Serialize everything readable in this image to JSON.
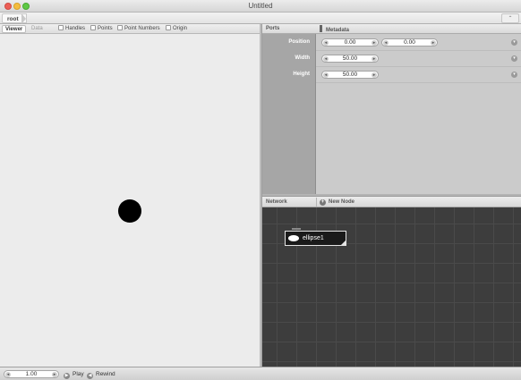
{
  "window": {
    "title": "Untitled"
  },
  "breadcrumb": {
    "root": "root"
  },
  "viewer": {
    "tabs": {
      "viewer": "Viewer",
      "data": "Data"
    },
    "checkboxes": {
      "handles": "Handles",
      "points": "Points",
      "point_numbers": "Point Numbers",
      "origin": "Origin"
    }
  },
  "ports": {
    "header": {
      "ports": "Ports",
      "metadata": "Metadata"
    },
    "rows": {
      "position": {
        "label": "Position",
        "x": "0.00",
        "y": "0.00"
      },
      "width": {
        "label": "Width",
        "value": "50.00"
      },
      "height": {
        "label": "Height",
        "value": "50.00"
      }
    }
  },
  "network": {
    "header": {
      "title": "Network",
      "new_node": "New Node"
    },
    "node": {
      "label": "ellipse1"
    }
  },
  "playback": {
    "frame": "1.00",
    "play": "Play",
    "rewind": "Rewind"
  },
  "colors": {
    "node_bg": "#1a1a1a",
    "network_bg": "#3b3b3b",
    "ellipse": "#000000"
  }
}
